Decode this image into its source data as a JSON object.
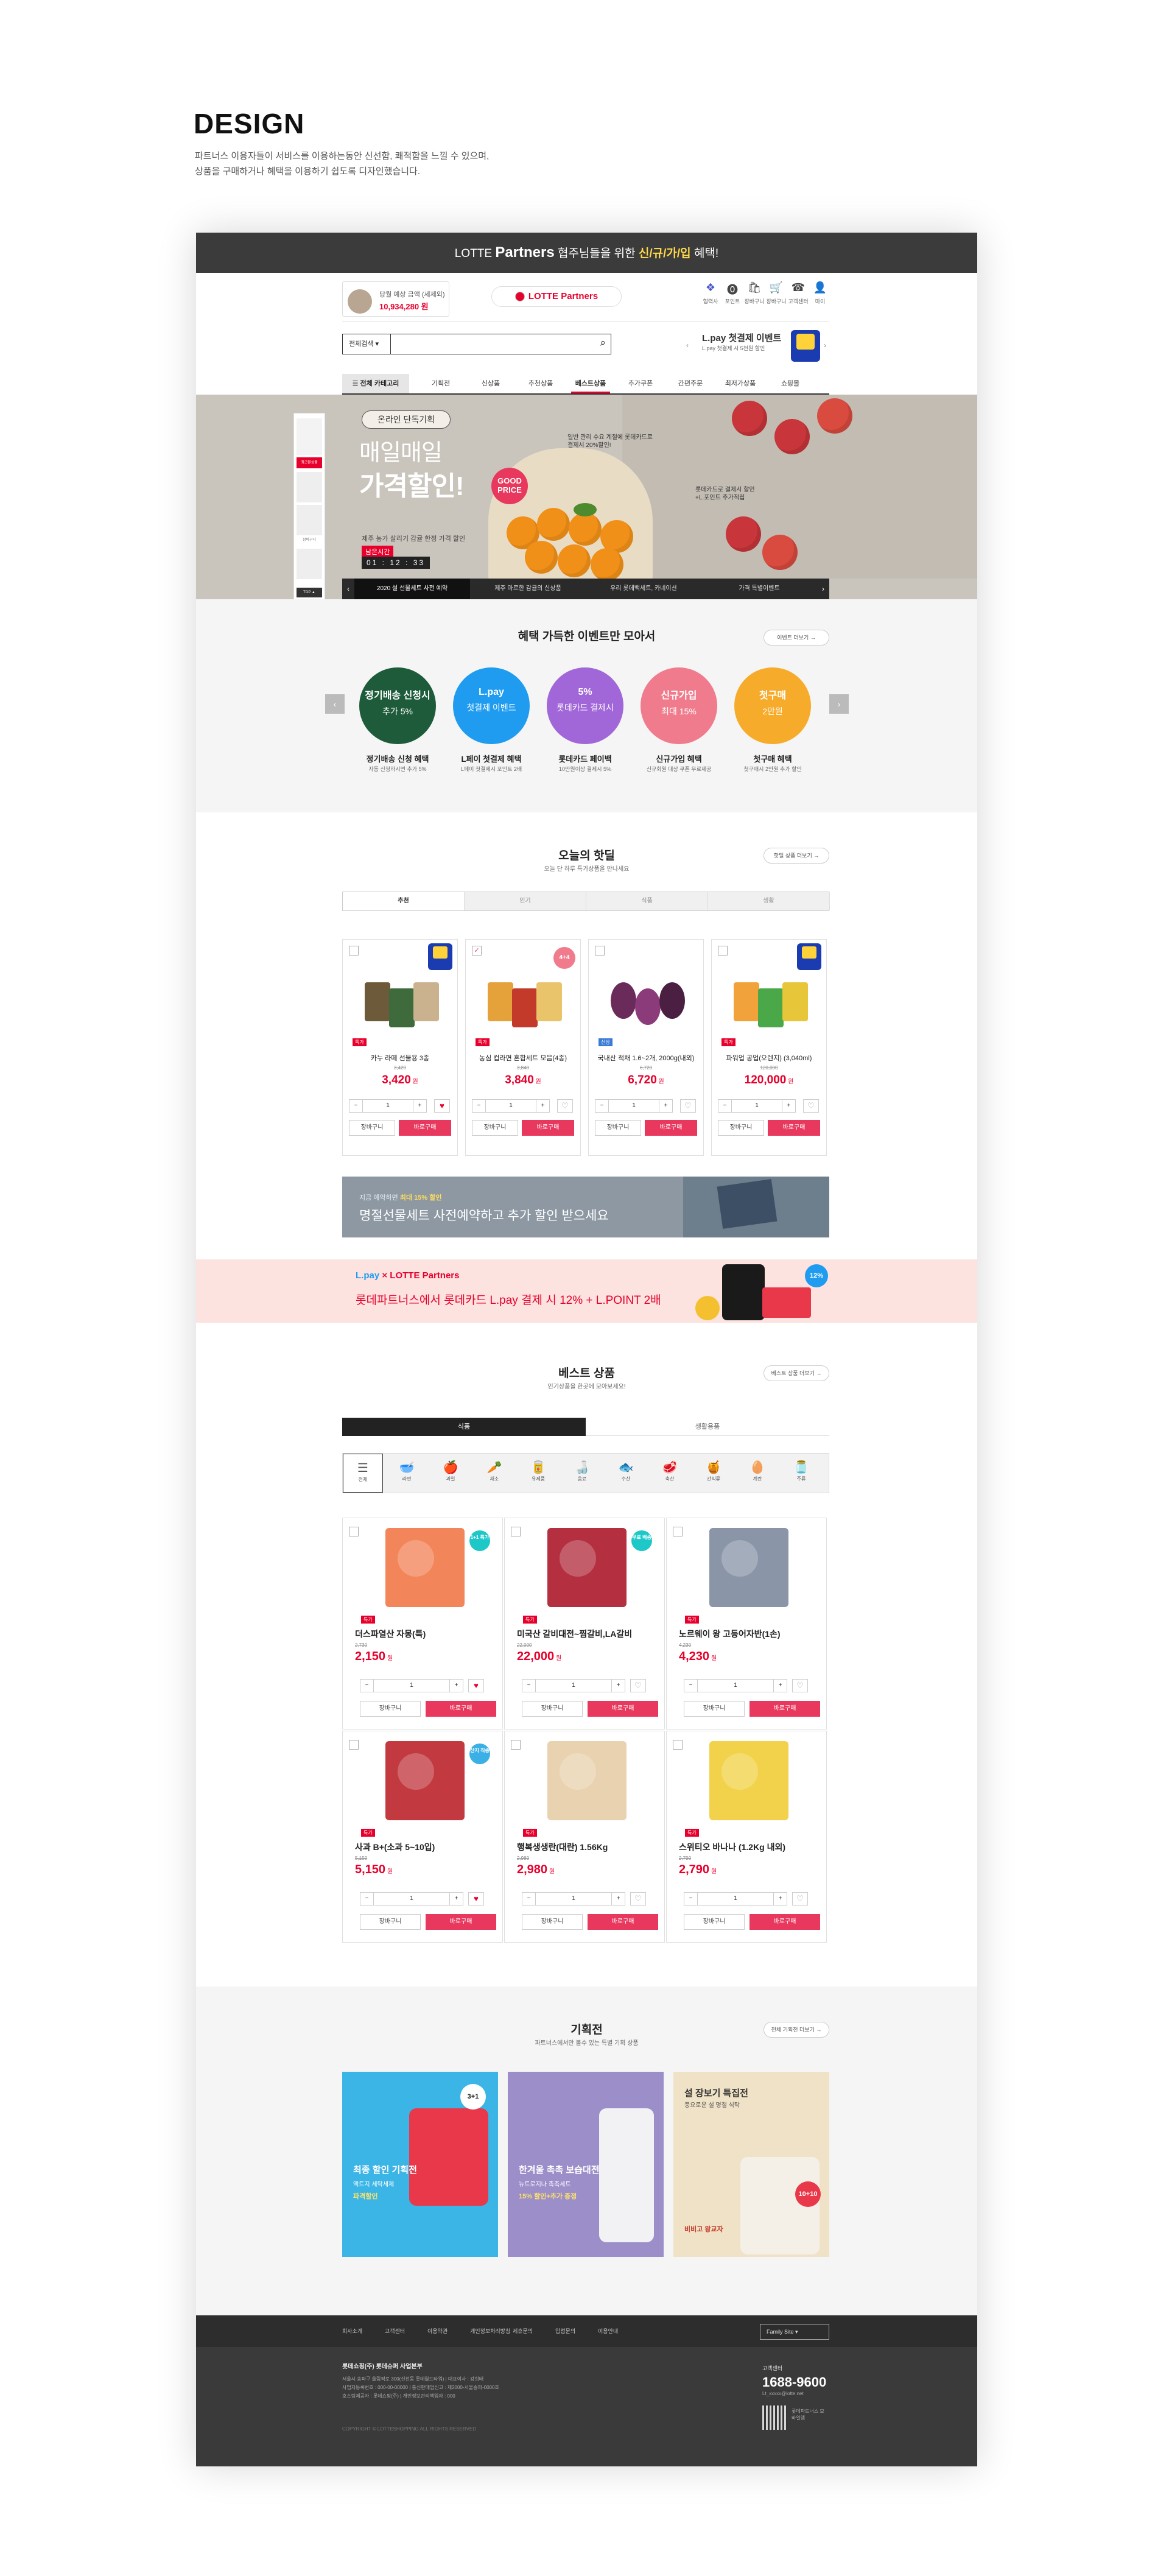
{
  "design": {
    "title": "DESIGN",
    "desc1": "파트너스 이용자들이 서비스를 이용하는동안 신선함, 쾌적함을 느낄 수 있으며,",
    "desc2": "상품을 구매하거나 혜택을 이용하기 쉽도록 디자인했습니다."
  },
  "topbar": {
    "pre": "LOTTE ",
    "brand": "Partners",
    "mid": " 협주님들을 위한 ",
    "hl": "신/규/가/입",
    "post": " 혜택!"
  },
  "header": {
    "buy_label": "당월 예상 금액 (세제외)",
    "buy_amount": "10,934,280 원",
    "logo": "LOTTE Partners",
    "icons": [
      {
        "name": "shield-icon",
        "glyph": "❖",
        "label": "협력사"
      },
      {
        "name": "info-icon",
        "glyph": "⓿",
        "label": "포인트"
      },
      {
        "name": "bag-icon",
        "glyph": "🛍",
        "label": "장바구니"
      },
      {
        "name": "cart-icon",
        "glyph": "🛒",
        "label": "장바구니"
      },
      {
        "name": "headset-icon",
        "glyph": "☎",
        "label": "고객센터"
      },
      {
        "name": "user-icon",
        "glyph": "👤",
        "label": "마이"
      }
    ],
    "search_select": "전체검색",
    "search_placeholder": "",
    "lpay_title": "L.pay 첫결제 이벤트",
    "lpay_desc": "L.pay 첫결제 시 5천원 할인"
  },
  "nav": {
    "all_cat": "☰ 전체 카테고리",
    "items": [
      "기획전",
      "신상품",
      "추천상품",
      "베스트상품",
      "추가쿠폰",
      "간편주문",
      "최저가상품",
      "쇼핑몰"
    ]
  },
  "hero": {
    "badge": "온라인 단독기획",
    "line1": "매일매일",
    "line2": "가격할인!",
    "small": "제주 농가 살리기 감귤 한정 가격 할인",
    "countdown_label": "남은시간",
    "countdown": "01 : 12 : 33",
    "discount": "GOOD PRICE",
    "note1": "일반 관리 수요 계절에 롯데카드로 결제시 20%할인!",
    "note2": "롯데카드로 결제시 할인+L.포인트 추가적립",
    "tabs": [
      "2020 설 선물세트 사전 예약",
      "제주 마르한 감귤의 신상품",
      "우리 롯데백세트, 카네이션",
      "가격 특별이벤트"
    ]
  },
  "sidebar": {
    "items": [
      "최근본상품",
      "장바구니",
      "TOP ▲"
    ]
  },
  "events": {
    "title": "혜택 가득한 이벤트만 모아서",
    "more": "이벤트 더보기 →",
    "items": [
      {
        "circle_a": "정기배송 신청시",
        "circle_b": "추가 5%",
        "color": "#1e5b3a",
        "title": "정기배송 신청 혜택",
        "desc": "자동 신청하시면 추가 5%"
      },
      {
        "circle_a": "L.pay",
        "circle_b": "첫결제 이벤트",
        "color": "#1f9cf0",
        "title": "L페이 첫결제 혜택",
        "desc": "L페이 첫결제시 포인트 2배"
      },
      {
        "circle_a": "5%",
        "circle_b": "롯데카드 결제시",
        "color": "#a167d8",
        "title": "롯데카드 페이백",
        "desc": "10만원이상 결제시 5%"
      },
      {
        "circle_a": "신규가입",
        "circle_b": "최대 15%",
        "color": "#f07b8c",
        "title": "신규가입 혜택",
        "desc": "신규회원 대상 쿠폰 무료제공"
      },
      {
        "circle_a": "첫구매",
        "circle_b": "2만원",
        "color": "#f7ab2b",
        "title": "첫구매 혜택",
        "desc": "첫구매시 2만원 추가 할인"
      }
    ]
  },
  "hot": {
    "title": "오늘의 핫딜",
    "sub": "오늘 단 하루 특가상품을 만나세요",
    "more": "핫딜 상품 더보기 →",
    "tabs": [
      "추천",
      "인기",
      "식품",
      "생활"
    ],
    "cart": "장바구니",
    "buy": "바로구매",
    "products": [
      {
        "name": "카누 라떼 선물용 3종",
        "org": "3,420",
        "price": "3,420",
        "qty": "1",
        "liked": true,
        "checked": false,
        "tag": "특가",
        "tagc": "#e8002c"
      },
      {
        "name": "농심 컵라면 혼합세트 모음(4종)",
        "org": "3,840",
        "price": "3,840",
        "qty": "1",
        "liked": false,
        "checked": true,
        "tag": "특가",
        "tagc": "#e8002c"
      },
      {
        "name": "국내산 적채 1.6~2개, 2000g(내외)",
        "org": "6,720",
        "price": "6,720",
        "qty": "1",
        "liked": false,
        "checked": false,
        "tag": "신상",
        "tagc": "#3a7bd5"
      },
      {
        "name": "파워업 공업(오렌지) (3,040ml)",
        "org": "120,000",
        "price": "120,000",
        "qty": "1",
        "liked": false,
        "checked": false,
        "tag": "특가",
        "tagc": "#e8002c"
      }
    ]
  },
  "banner1": {
    "a_pre": "지금 예약하면 ",
    "a_hl": "최대 15% 할인",
    "b": "명절선물세트 사전예약하고 추가 할인 받으세요"
  },
  "banner2": {
    "a1": "L.pay",
    "a2": " × LOTTE Partners",
    "b_pre": "롯데파트너스에서 롯데카드 L.pay 결제 시 ",
    "b_hl": "12% + L.POINT 2배",
    "badge": "12%"
  },
  "best": {
    "title": "베스트 상품",
    "sub": "인기상품을 한곳에 모아보세요!",
    "more": "베스트 상품 더보기 →",
    "tabs": [
      "식품",
      "생활용품"
    ],
    "cats": [
      {
        "g": "☰",
        "l": "전체",
        "name": "all-icon"
      },
      {
        "g": "🥣",
        "l": "라면",
        "name": "bowl-icon"
      },
      {
        "g": "🍎",
        "l": "과일",
        "name": "apple-icon"
      },
      {
        "g": "🥕",
        "l": "채소",
        "name": "carrot-icon"
      },
      {
        "g": "🥫",
        "l": "유제품",
        "name": "can-icon"
      },
      {
        "g": "🍶",
        "l": "음료",
        "name": "bottle-icon"
      },
      {
        "g": "🐟",
        "l": "수산",
        "name": "fish-icon"
      },
      {
        "g": "🥩",
        "l": "축산",
        "name": "meat-icon"
      },
      {
        "g": "🍯",
        "l": "간식류",
        "name": "honey-icon"
      },
      {
        "g": "🥚",
        "l": "계란",
        "name": "egg-icon"
      },
      {
        "g": "🫙",
        "l": "주류",
        "name": "jar-icon"
      }
    ],
    "cart": "장바구니",
    "buy": "바로구매",
    "products": [
      {
        "name": "더스파열산 자몽(특)",
        "org": "2,730",
        "price": "2,150",
        "qty": "1",
        "liked": true,
        "badge": "1+1 특가",
        "badgec": "#1ec8c8",
        "color": "#f2855a"
      },
      {
        "name": "미국산 갈비대전~찜갈비,LA갈비",
        "org": "22,000",
        "price": "22,000",
        "qty": "1",
        "liked": false,
        "badge": "무료 배송",
        "badgec": "#1ec8c8",
        "color": "#b43040"
      },
      {
        "name": "노르웨이 왕 고등어자반(1손)",
        "org": "4,230",
        "price": "4,230",
        "qty": "1",
        "liked": false,
        "badge": "",
        "badgec": "",
        "color": "#8a96a8"
      },
      {
        "name": "사과 B+(소과 5~10입)",
        "org": "5,150",
        "price": "5,150",
        "qty": "1",
        "liked": true,
        "badge": "산지 직송",
        "badgec": "#3ab0e6",
        "color": "#c23a40"
      },
      {
        "name": "행복생생란(대란) 1.56Kg",
        "org": "2,980",
        "price": "2,980",
        "qty": "1",
        "liked": false,
        "badge": "",
        "badgec": "",
        "color": "#e9d2b0"
      },
      {
        "name": "스위티오 바나나 (1.2Kg 내외)",
        "org": "2,790",
        "price": "2,790",
        "qty": "1",
        "liked": false,
        "badge": "",
        "badgec": "",
        "color": "#f2d24a"
      }
    ]
  },
  "plan": {
    "title": "기획전",
    "sub": "파트너스에서만 볼수 있는 특별 기획 상품",
    "more": "전체 기획전 더보기 →",
    "cards": [
      {
        "t1": "최종 할인 기획전",
        "t2": "액트지 세탁세제",
        "t3": "파격할인",
        "badge": "3+1",
        "bg": "#3bb4e6"
      },
      {
        "t1": "한겨울 촉촉 보습대전",
        "t2": "뉴트로지나 촉촉세트",
        "t3": "15% 할인+추가 증정",
        "badge": "",
        "bg": "#9b8ec9"
      },
      {
        "t1": "설 장보기 특집전",
        "t2": "풍요로운 설 명절 식탁",
        "t3": "비비고 왕교자",
        "badge": "10+10",
        "bg": "#f0e2c6"
      }
    ]
  },
  "footer": {
    "nav": [
      "회사소개",
      "고객센터",
      "이용약관",
      "개인정보처리방침",
      "제휴문의",
      "입점문의",
      "이용안내"
    ],
    "family": "Family Site",
    "company": "롯데쇼핑(주) 롯데슈퍼 사업본부",
    "line1": "서울시 송파구 올림픽로 300(신천동 롯데월드타워) | 대표이사 : 강희태",
    "line2": "사업자등록번호 : 000-00-00000 | 통신판매업신고 : 제2000-서울송파-0000호",
    "line3": "호스팅제공자 : 롯데쇼핑(주) | 개인정보관리책임자 : 000",
    "copy": "COPYRIGHT © LOTTESHOPPING ALL RIGHTS RESERVED",
    "cs_label": "고객센터",
    "cs_num": "1688-9600",
    "cs_mail": "Lt_xxxxx@lotte.net",
    "app": "롯데파트너스 모바일앱"
  }
}
